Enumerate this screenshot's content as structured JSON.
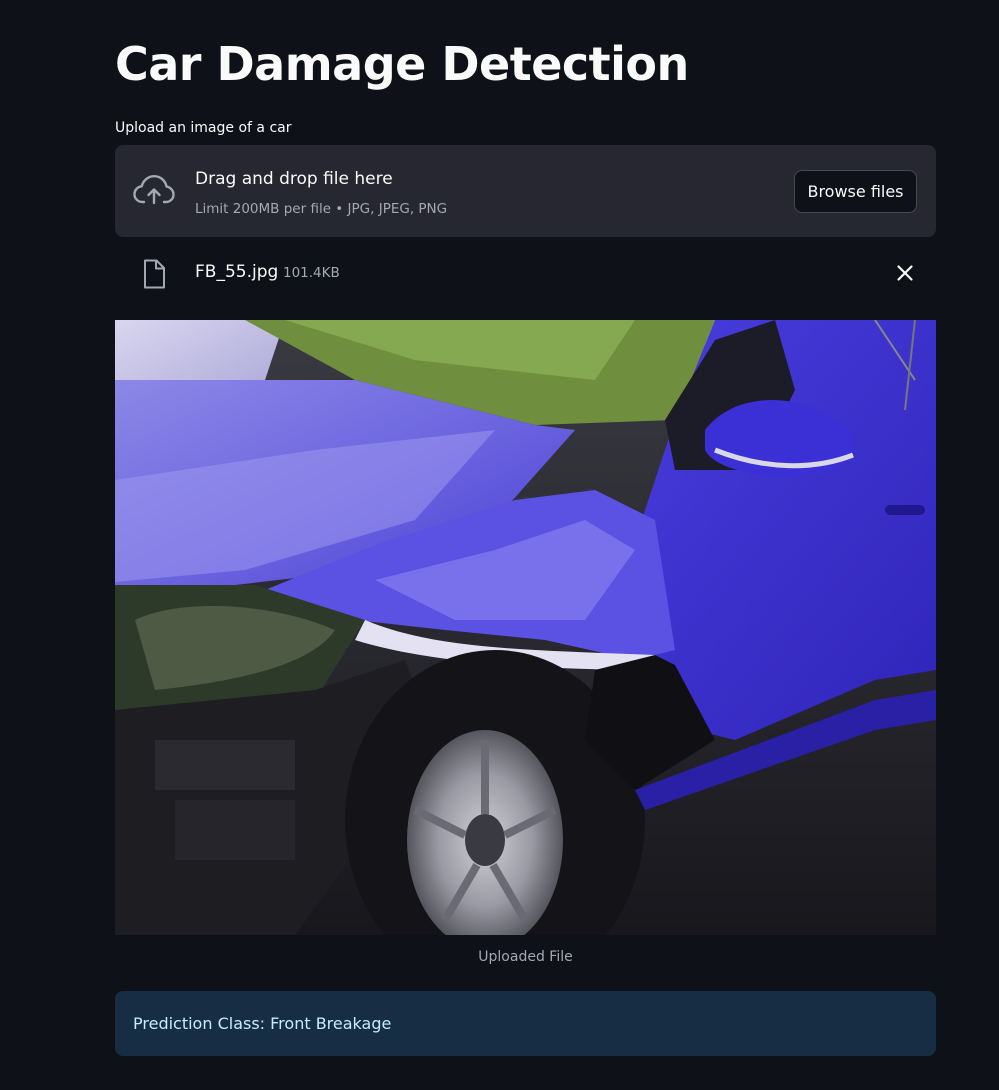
{
  "app": {
    "title": "Car Damage Detection"
  },
  "uploader": {
    "label": "Upload an image of a car",
    "drop_text": "Drag and drop file here",
    "limit_text": "Limit 200MB per file • JPG, JPEG, PNG",
    "browse_label": "Browse files",
    "upload_icon": "cloud-upload-icon"
  },
  "file": {
    "name": "FB_55.jpg",
    "size": "101.4KB",
    "file_icon": "document-icon",
    "remove_icon": "close-icon"
  },
  "image": {
    "caption": "Uploaded File",
    "subject": "blue car with damaged front fender"
  },
  "result": {
    "text": "Prediction Class: Front Breakage",
    "color": "#172d43"
  },
  "colors": {
    "background": "#0e1117",
    "dropzone": "#262730",
    "text": "#fafafa",
    "muted": "#a3a8b4",
    "info_text": "#c7ebff"
  }
}
